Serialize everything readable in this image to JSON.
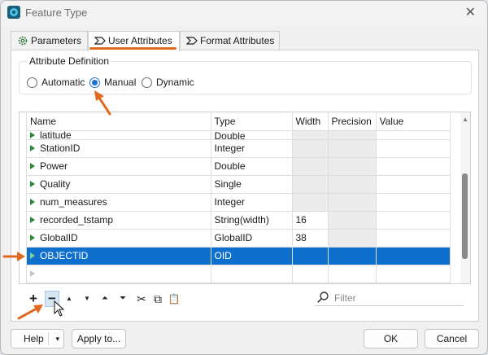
{
  "window": {
    "title": "Feature Type",
    "close_glyph": "✕"
  },
  "tabs": [
    {
      "label": "Parameters",
      "icon": "gear-icon"
    },
    {
      "label": "User Attributes",
      "icon": "attribute-icon",
      "active": true
    },
    {
      "label": "Format Attributes",
      "icon": "attribute-icon"
    }
  ],
  "attribute_definition": {
    "title": "Attribute Definition",
    "options": [
      {
        "label": "Automatic",
        "selected": false
      },
      {
        "label": "Manual",
        "selected": true
      },
      {
        "label": "Dynamic",
        "selected": false
      }
    ]
  },
  "table": {
    "columns": [
      "Name",
      "Type",
      "Width",
      "Precision",
      "Value"
    ],
    "partial_row": {
      "name": "latitude",
      "type": "Double"
    },
    "rows": [
      {
        "name": "StationID",
        "type": "Integer",
        "width": "",
        "precision": "",
        "value": ""
      },
      {
        "name": "Power",
        "type": "Double",
        "width": "",
        "precision": "",
        "value": ""
      },
      {
        "name": "Quality",
        "type": "Single",
        "width": "",
        "precision": "",
        "value": ""
      },
      {
        "name": "num_measures",
        "type": "Integer",
        "width": "",
        "precision": "",
        "value": ""
      },
      {
        "name": "recorded_tstamp",
        "type": "String(width)",
        "width": "16",
        "precision": "",
        "value": ""
      },
      {
        "name": "GlobalID",
        "type": "GlobalID",
        "width": "38",
        "precision": "",
        "value": ""
      },
      {
        "name": "OBJECTID",
        "type": "OID",
        "width": "",
        "precision": "",
        "value": "",
        "selected": true
      }
    ]
  },
  "toolbar": {
    "add": "+",
    "remove": "−",
    "move_up": "▲",
    "move_down": "▼",
    "move_top": "⏶",
    "move_bottom": "⏷",
    "cut": "✂",
    "copy": "⧉",
    "paste": "📋"
  },
  "filter": {
    "placeholder": "Filter",
    "value": ""
  },
  "buttons": {
    "help": "Help",
    "help_caret": "▾",
    "apply_to": "Apply to...",
    "ok": "OK",
    "cancel": "Cancel"
  },
  "colors": {
    "accent": "#e06a22",
    "selection": "#0f6fcd",
    "radio": "#1a73d9",
    "row_arrow": "#2d8a3a"
  }
}
